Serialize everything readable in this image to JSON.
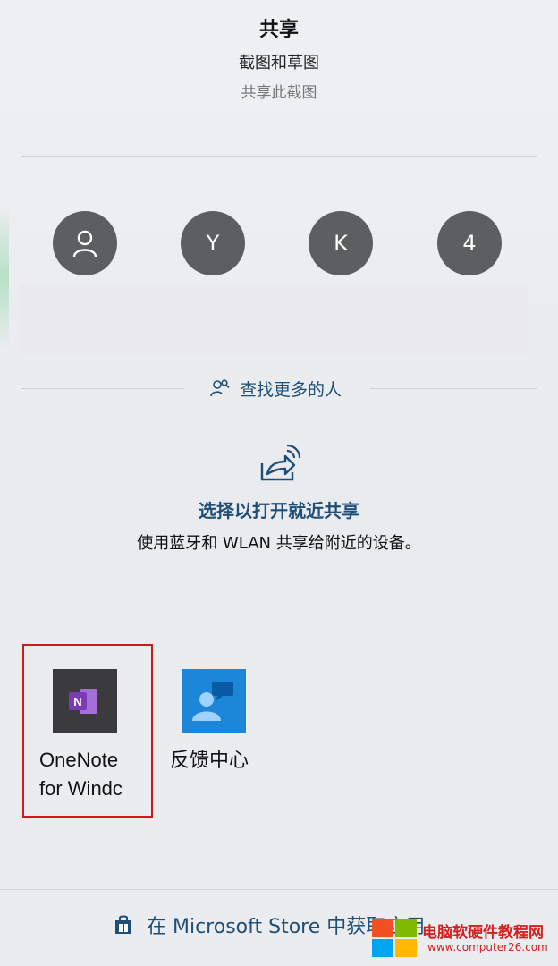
{
  "header": {
    "title": "共享",
    "subtitle": "截图和草图",
    "description": "共享此截图"
  },
  "contacts": [
    {
      "label": "",
      "icon": "person-icon"
    },
    {
      "label": "Y"
    },
    {
      "label": "K"
    },
    {
      "label": "4"
    }
  ],
  "find_more": {
    "label": "查找更多的人",
    "icon": "people-search-icon"
  },
  "nearby": {
    "icon": "nearby-share-icon",
    "title": "选择以打开就近共享",
    "description": "使用蓝牙和 WLAN 共享给附近的设备。"
  },
  "apps": [
    {
      "label": "OneNote\nfor Windc",
      "icon": "onenote-icon",
      "highlighted": true
    },
    {
      "label": "反馈中心",
      "icon": "feedback-hub-icon"
    }
  ],
  "footer": {
    "store_label": "在 Microsoft Store 中获取应用",
    "icon": "store-bag-icon"
  },
  "watermark": {
    "text": "电脑软硬件教程网",
    "url": "www.computer26.com"
  },
  "colors": {
    "accent": "#1f4e78",
    "avatar": "#5d5e60",
    "highlight_box": "#d0181f",
    "onenote_purple": "#7b3bb5",
    "feedback_blue": "#0078d4"
  }
}
